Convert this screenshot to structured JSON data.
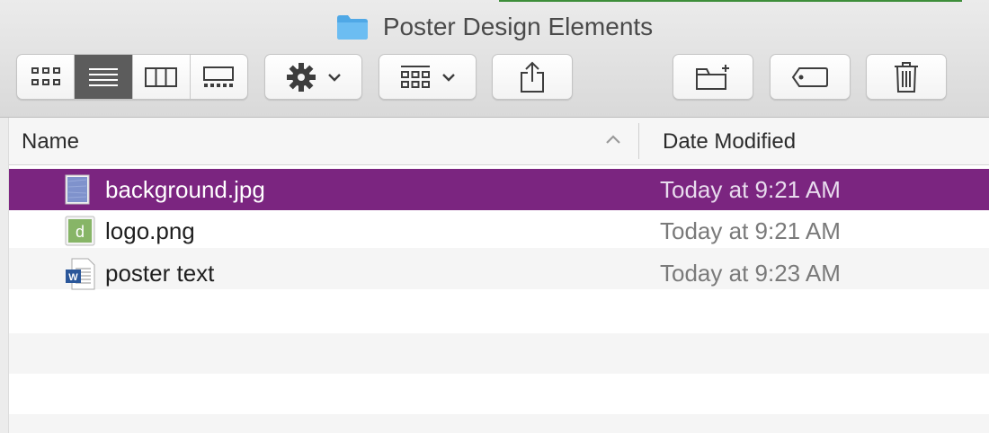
{
  "window": {
    "title": "Poster Design Elements",
    "accent_color": "#3e8e3a"
  },
  "toolbar": {
    "view_modes": [
      "icon-view",
      "list-view",
      "column-view",
      "gallery-view"
    ],
    "active_view": "list-view",
    "action_menu_icon": "gear-icon",
    "group_menu_icon": "group-grid-icon",
    "share_icon": "share-icon",
    "new_folder_icon": "new-folder-icon",
    "tag_icon": "tag-icon",
    "trash_icon": "trash-icon"
  },
  "columns": {
    "name": "Name",
    "date_modified": "Date Modified",
    "sort_direction": "ascending"
  },
  "files": [
    {
      "name": "background.jpg",
      "date": "Today at 9:21 AM",
      "icon": "image-file-icon",
      "selected": true
    },
    {
      "name": "logo.png",
      "date": "Today at 9:21 AM",
      "icon": "png-file-icon",
      "selected": false
    },
    {
      "name": "poster text",
      "date": "Today at 9:23 AM",
      "icon": "word-document-icon",
      "selected": false
    }
  ],
  "colors": {
    "selection": "#7b2580",
    "stripe": "#f5f5f5",
    "folder": "#64b7ee"
  }
}
